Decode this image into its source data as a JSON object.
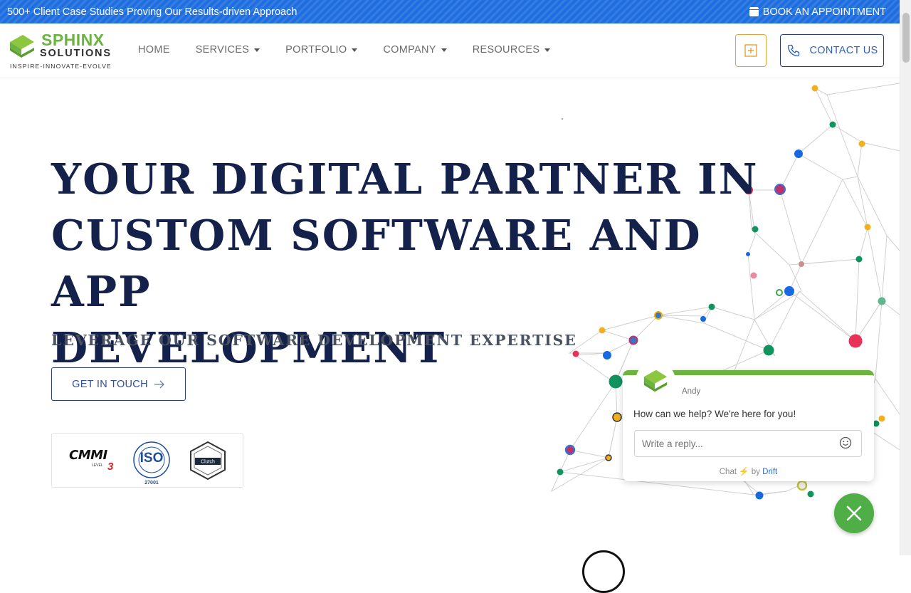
{
  "topbar": {
    "promo": "500+ Client Case Studies Proving Our Results-driven Approach",
    "book_label": "BOOK AN APPOINTMENT",
    "book_icon": "calendar-icon",
    "bg_color": "#1f6ee0"
  },
  "logo": {
    "line1": "SPHINX",
    "line2": "SOLUTIONS",
    "tagline": "INSPIRE-INNOVATE-EVOLVE"
  },
  "nav": {
    "items": [
      {
        "label": "HOME",
        "has_dropdown": false
      },
      {
        "label": "SERVICES",
        "has_dropdown": true
      },
      {
        "label": "PORTFOLIO",
        "has_dropdown": true
      },
      {
        "label": "COMPANY",
        "has_dropdown": true
      },
      {
        "label": "RESOURCES",
        "has_dropdown": true
      }
    ],
    "plus_icon": "plus-square-icon",
    "contact_label": "CONTACT US",
    "contact_icon": "phone-icon"
  },
  "hero": {
    "headline_lines": [
      "YOUR DIGITAL PARTNER IN",
      "CUSTOM SOFTWARE AND APP",
      "DEVELOPMENT"
    ],
    "subheadline": "LEVERAGE OUR SOFTWARE DEVELOPMENT EXPERTISE",
    "cta_label": "GET IN TOUCH",
    "cta_icon": "arrow-right-icon",
    "headline_color": "#14214a"
  },
  "badges": {
    "cmmi": {
      "text": "CMMI",
      "level_small": "LEVEL",
      "level": "3"
    },
    "iso": {
      "text": "ISO",
      "number": "27001"
    },
    "clutch": {
      "text": "Clutch"
    }
  },
  "chat": {
    "agent_name": "Andy",
    "message": "How can we help? We're here for you!",
    "reply_placeholder": "Write a reply...",
    "emoji_icon": "smiley-icon",
    "powered_prefix": "Chat",
    "powered_by": "by",
    "powered_brand": "Drift",
    "accent_color": "#6cb33f",
    "close_icon": "close-icon"
  }
}
